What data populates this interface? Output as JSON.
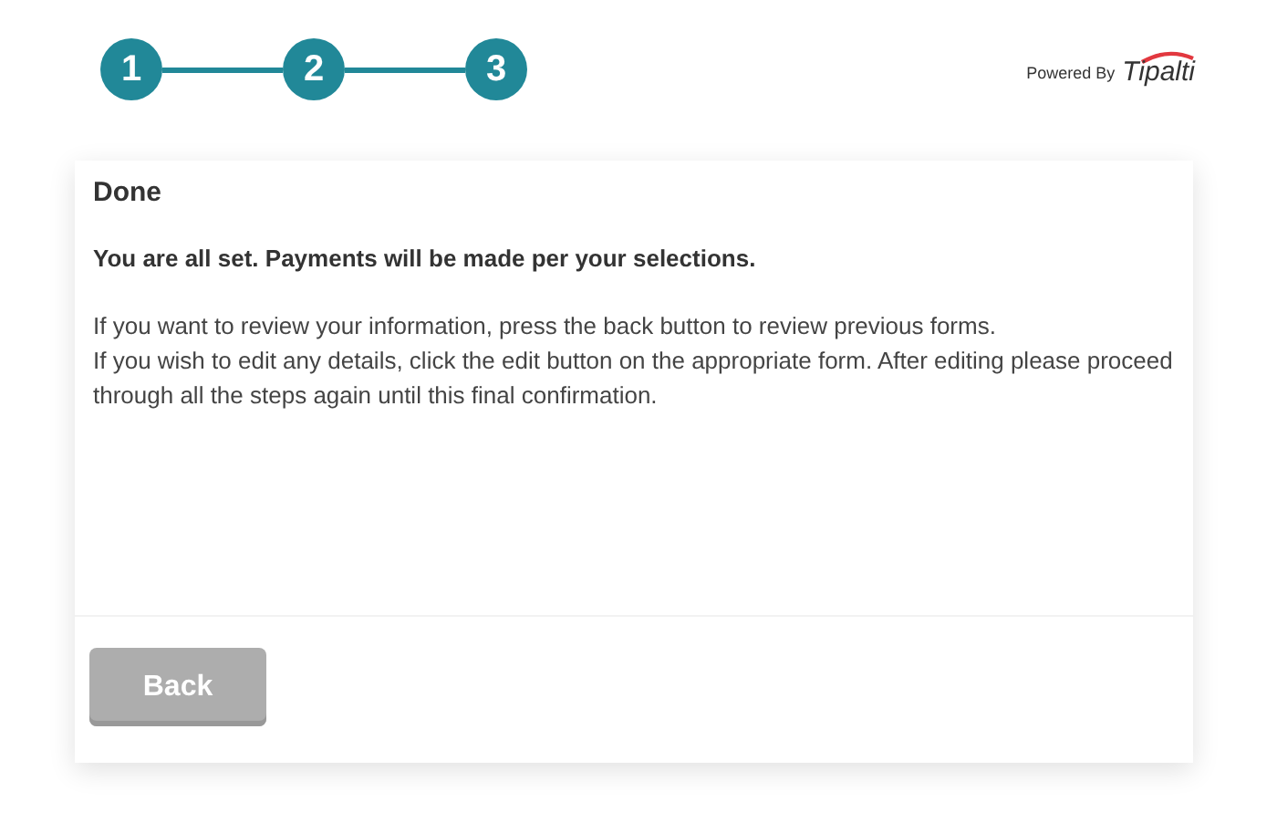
{
  "steps": [
    {
      "label": "1"
    },
    {
      "label": "2"
    },
    {
      "label": "3"
    }
  ],
  "branding": {
    "prefix": "Powered By",
    "name": "Tipalti"
  },
  "card": {
    "title": "Done",
    "headline": "You are all set. Payments will be made per your selections.",
    "paragraphs": [
      "If you want to review your information, press the back button to review previous forms.",
      "If you wish to edit any details, click the edit button on the appropriate form. After editing please proceed through all the steps again until this final confirmation."
    ]
  },
  "buttons": [
    {
      "label": "Back",
      "disabled": true
    }
  ]
}
